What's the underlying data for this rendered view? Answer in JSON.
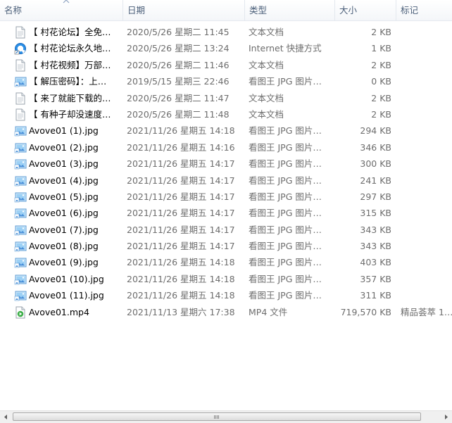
{
  "columns": {
    "name": "名称",
    "date": "日期",
    "type": "类型",
    "size": "大小",
    "tag": "标记"
  },
  "files": [
    {
      "icon": "text-file-icon",
      "name": "【 村花论坛】全免…",
      "date": "2020/5/26 星期二 11:45",
      "type": "文本文档",
      "size": "2 KB",
      "tag": ""
    },
    {
      "icon": "internet-shortcut-icon",
      "name": "【 村花论坛永久地…",
      "date": "2020/5/26 星期二 13:24",
      "type": "Internet 快捷方式",
      "size": "1 KB",
      "tag": ""
    },
    {
      "icon": "text-file-icon",
      "name": "【 村花视频】万部…",
      "date": "2020/5/26 星期二 11:46",
      "type": "文本文档",
      "size": "2 KB",
      "tag": ""
    },
    {
      "icon": "image-file-icon",
      "name": "【 解压密码】：上…",
      "date": "2019/5/15 星期三 22:46",
      "type": "看图王 JPG 图片…",
      "size": "0 KB",
      "tag": ""
    },
    {
      "icon": "text-file-icon",
      "name": "【 来了就能下载的…",
      "date": "2020/5/26 星期二 11:47",
      "type": "文本文档",
      "size": "2 KB",
      "tag": ""
    },
    {
      "icon": "text-file-icon",
      "name": "【 有种子却没速度…",
      "date": "2020/5/26 星期二 11:48",
      "type": "文本文档",
      "size": "2 KB",
      "tag": ""
    },
    {
      "icon": "image-file-icon",
      "name": "Avove01 (1).jpg",
      "date": "2021/11/26 星期五 14:18",
      "type": "看图王 JPG 图片…",
      "size": "294 KB",
      "tag": ""
    },
    {
      "icon": "image-file-icon",
      "name": "Avove01 (2).jpg",
      "date": "2021/11/26 星期五 14:16",
      "type": "看图王 JPG 图片…",
      "size": "346 KB",
      "tag": ""
    },
    {
      "icon": "image-file-icon",
      "name": "Avove01 (3).jpg",
      "date": "2021/11/26 星期五 14:17",
      "type": "看图王 JPG 图片…",
      "size": "300 KB",
      "tag": ""
    },
    {
      "icon": "image-file-icon",
      "name": "Avove01 (4).jpg",
      "date": "2021/11/26 星期五 14:17",
      "type": "看图王 JPG 图片…",
      "size": "241 KB",
      "tag": ""
    },
    {
      "icon": "image-file-icon",
      "name": "Avove01 (5).jpg",
      "date": "2021/11/26 星期五 14:17",
      "type": "看图王 JPG 图片…",
      "size": "297 KB",
      "tag": ""
    },
    {
      "icon": "image-file-icon",
      "name": "Avove01 (6).jpg",
      "date": "2021/11/26 星期五 14:17",
      "type": "看图王 JPG 图片…",
      "size": "315 KB",
      "tag": ""
    },
    {
      "icon": "image-file-icon",
      "name": "Avove01 (7).jpg",
      "date": "2021/11/26 星期五 14:17",
      "type": "看图王 JPG 图片…",
      "size": "343 KB",
      "tag": ""
    },
    {
      "icon": "image-file-icon",
      "name": "Avove01 (8).jpg",
      "date": "2021/11/26 星期五 14:17",
      "type": "看图王 JPG 图片…",
      "size": "343 KB",
      "tag": ""
    },
    {
      "icon": "image-file-icon",
      "name": "Avove01 (9).jpg",
      "date": "2021/11/26 星期五 14:18",
      "type": "看图王 JPG 图片…",
      "size": "403 KB",
      "tag": ""
    },
    {
      "icon": "image-file-icon",
      "name": "Avove01 (10).jpg",
      "date": "2021/11/26 星期五 14:18",
      "type": "看图王 JPG 图片…",
      "size": "357 KB",
      "tag": ""
    },
    {
      "icon": "image-file-icon",
      "name": "Avove01 (11).jpg",
      "date": "2021/11/26 星期五 14:18",
      "type": "看图王 JPG 图片…",
      "size": "311 KB",
      "tag": ""
    },
    {
      "icon": "video-file-icon",
      "name": "Avove01.mp4",
      "date": "2021/11/13 星期六 17:38",
      "type": "MP4 文件",
      "size": "719,570 KB",
      "tag": "精品荟萃 1…"
    }
  ],
  "colors": {
    "header_text": "#4c607a",
    "detail_text": "#6d6d6d"
  }
}
